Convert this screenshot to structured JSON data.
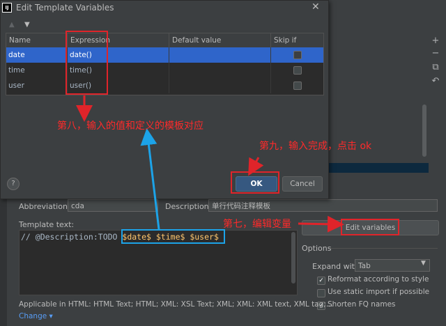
{
  "dialog": {
    "title": "Edit Template Variables",
    "close_icon": "close-icon",
    "toolbar": {
      "up_icon": "arrow-up-icon",
      "down_icon": "arrow-down-icon"
    },
    "columns": [
      "Name",
      "Expression",
      "Default value",
      "Skip if defined"
    ],
    "rows": [
      {
        "name": "date",
        "expression": "date()",
        "default": "",
        "skip": false,
        "selected": true
      },
      {
        "name": "time",
        "expression": "time()",
        "default": "",
        "skip": false,
        "selected": false
      },
      {
        "name": "user",
        "expression": "user()",
        "default": "",
        "skip": false,
        "selected": false
      }
    ],
    "help_label": "?",
    "ok_label": "OK",
    "cancel_label": "Cancel"
  },
  "settings": {
    "abbreviation_label": "Abbreviation:",
    "abbreviation_value": "cda",
    "description_label": "Description:",
    "description_value": "单行代码注释模板",
    "template_text_label": "Template text:",
    "template_prefix": "// @Description:TODO ",
    "template_vars": "$date$ $time$ $user$",
    "edit_variables_label": "Edit variables",
    "options_label": "Options",
    "expand_with_label": "Expand with",
    "expand_with_value": "Tab",
    "options": [
      {
        "label": "Reformat according to style",
        "checked": true
      },
      {
        "label": "Use static import if possible",
        "checked": false
      },
      {
        "label": "Shorten FQ names",
        "checked": true
      }
    ],
    "applicable_text": "Applicable in HTML: HTML Text; HTML; XML: XSL Text; XML; XML: XML text, XML tag;...",
    "change_label": "Change"
  },
  "annotations": {
    "step8": "第八，输入的值和定义的模板对应",
    "step9": "第九，输入完成，点击 ok",
    "step7": "第七，编辑变量"
  },
  "colors": {
    "annotation_red": "#e0242a",
    "annotation_blue": "#1ca3e8",
    "selection": "#2f65ca",
    "ok_button": "#365880"
  }
}
